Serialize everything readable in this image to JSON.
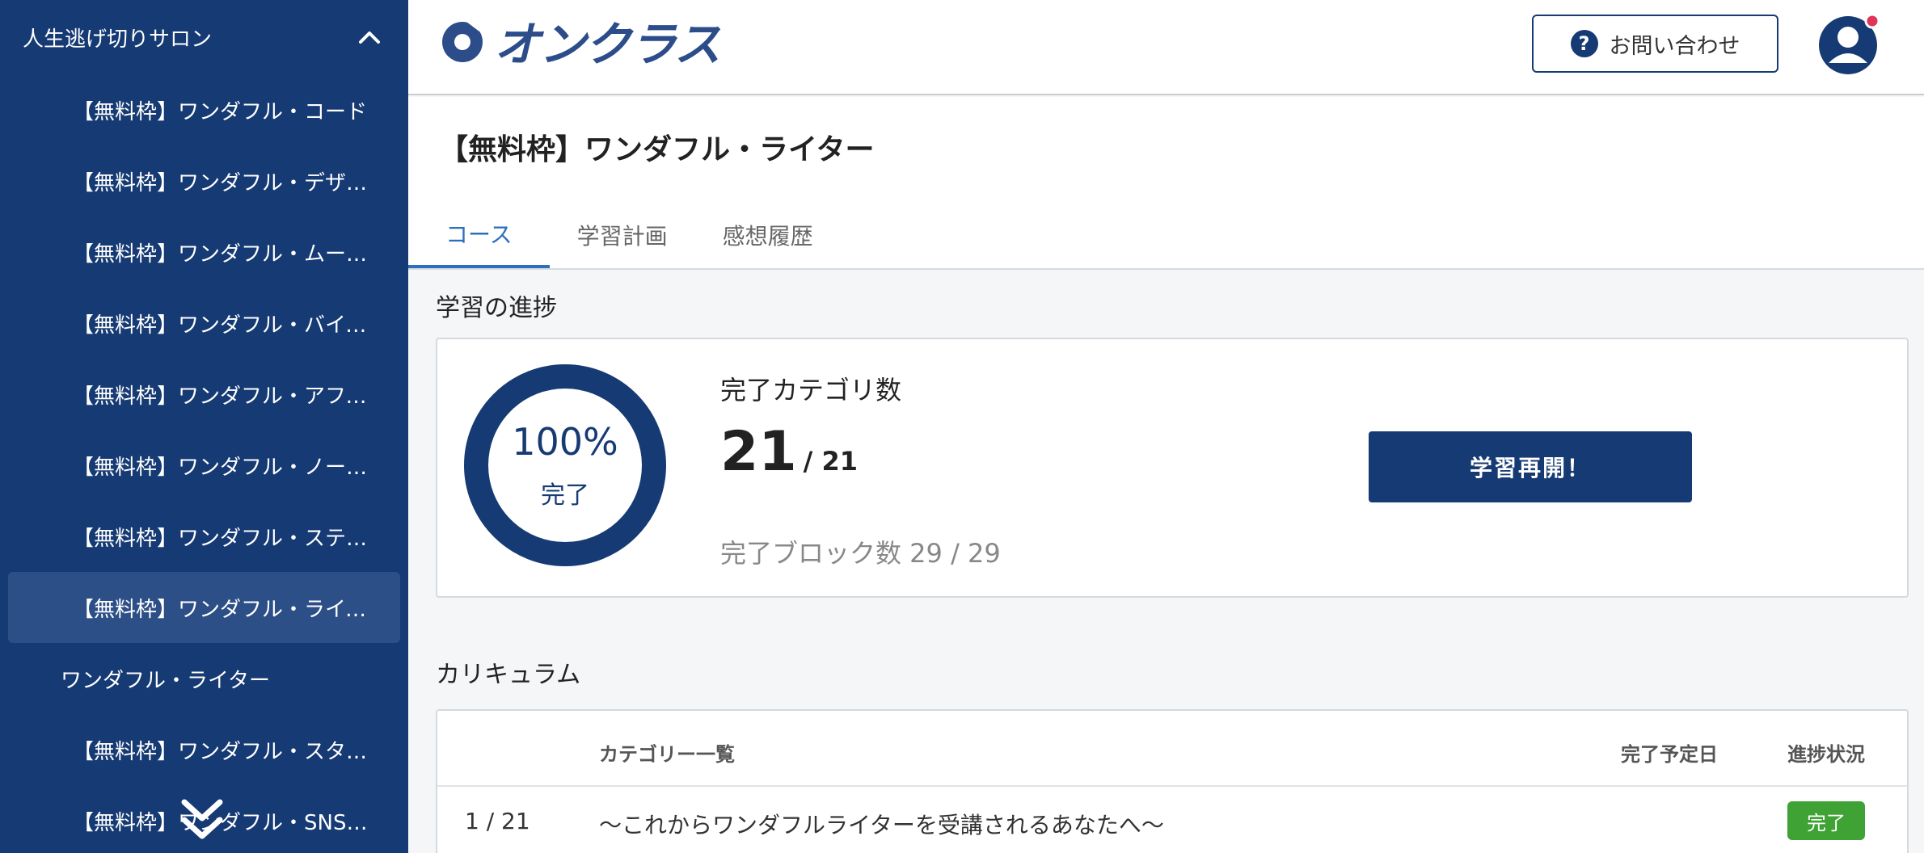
{
  "sidebar": {
    "group_title": "人生逃げ切りサロン",
    "items": [
      {
        "label": "【無料枠】ワンダフル・コード"
      },
      {
        "label": "【無料枠】ワンダフル・デザイナー"
      },
      {
        "label": "【無料枠】ワンダフル・ムービー"
      },
      {
        "label": "【無料枠】ワンダフル・バイヤー"
      },
      {
        "label": "【無料枠】ワンダフル・アフィリエイト"
      },
      {
        "label": "【無料枠】ワンダフル・ノーコード"
      },
      {
        "label": "【無料枠】ワンダフル・ステップ"
      },
      {
        "label": "【無料枠】ワンダフル・ライター"
      },
      {
        "label": "ワンダフル・ライター"
      },
      {
        "label": "【無料枠】ワンダフル・スタイリスト"
      },
      {
        "label": "【無料枠】ワンダフル・SNS・マーケ"
      }
    ]
  },
  "header": {
    "logo_text": "オンクラス",
    "contact_label": "お問い合わせ",
    "colors": {
      "brand": "#163a73",
      "logo": "#2d4d8a",
      "notification": "#e0355a"
    }
  },
  "course": {
    "title": "【無料枠】ワンダフル・ライター",
    "tabs": [
      {
        "label": "コース"
      },
      {
        "label": "学習計画"
      },
      {
        "label": "感想履歴"
      }
    ]
  },
  "progress": {
    "section_title": "学習の進捗",
    "percent_text": "100%",
    "percent_value": 1.0,
    "ring_label": "完了",
    "category_label": "完了カテゴリ数",
    "completed_categories": "21",
    "total_categories": "/ 21",
    "block_text": "完了ブロック数 29 / 29",
    "resume_label": "学習再開！"
  },
  "curriculum": {
    "section_title": "カリキュラム",
    "columns": {
      "list": "カテゴリー一覧",
      "due": "完了予定日",
      "status": "進捗状況"
    },
    "rows": [
      {
        "number": "1 / 21",
        "name": "〜これからワンダフルライターを受講されるあなたへ〜",
        "status": "完了"
      }
    ]
  }
}
